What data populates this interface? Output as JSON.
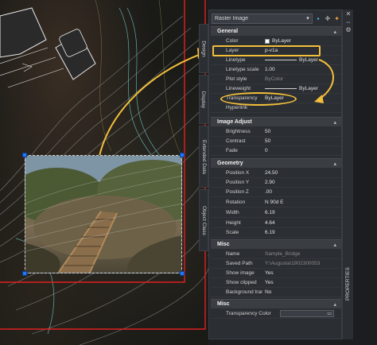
{
  "panel": {
    "selector_value": "Raster Image",
    "tool_icons": [
      "quick-select-icon",
      "select-objects-icon",
      "toggle-pickadd-icon"
    ],
    "side_label": "PROPERTIES"
  },
  "tabs": [
    "Design",
    "Display",
    "Extended Data",
    "Object Class"
  ],
  "sections": {
    "general": "General",
    "image_adjust": "Image Adjust",
    "geometry": "Geometry",
    "misc1": "Misc",
    "misc2": "Misc"
  },
  "general": [
    {
      "label": "Color",
      "value": "ByLayer"
    },
    {
      "label": "Layer",
      "value": "p-v1a"
    },
    {
      "label": "Linetype",
      "value": "ByLayer"
    },
    {
      "label": "Linetype scale",
      "value": "1.00"
    },
    {
      "label": "Plot style",
      "value": "ByColor"
    },
    {
      "label": "Lineweight",
      "value": "ByLayer"
    },
    {
      "label": "Transparency",
      "value": "ByLayer"
    },
    {
      "label": "Hyperlink",
      "value": ""
    }
  ],
  "image_adjust": [
    {
      "label": "Brightness",
      "value": "50"
    },
    {
      "label": "Contrast",
      "value": "50"
    },
    {
      "label": "Fade",
      "value": "0"
    }
  ],
  "geometry": [
    {
      "label": "Position X",
      "value": "24.50"
    },
    {
      "label": "Position Y",
      "value": "2.90"
    },
    {
      "label": "Position Z",
      "value": ".00"
    },
    {
      "label": "Rotation",
      "value": "N 90d E"
    },
    {
      "label": "Width",
      "value": "6.19"
    },
    {
      "label": "Height",
      "value": "4.64"
    },
    {
      "label": "Scale",
      "value": "6.19"
    }
  ],
  "misc1": [
    {
      "label": "Name",
      "value": "Sample_Bridge"
    },
    {
      "label": "Saved Path",
      "value": "Y:\\Augusta\\1902300053"
    },
    {
      "label": "Show image",
      "value": "Yes"
    },
    {
      "label": "Show clipped",
      "value": "Yes"
    },
    {
      "label": "Background trans...",
      "value": "No"
    }
  ],
  "misc2": [
    {
      "label": "Transparency Color",
      "value": ""
    }
  ],
  "colors": {
    "highlight": "#f2bf3b",
    "grip": "#1f78ff",
    "boundary": "#e02020"
  }
}
